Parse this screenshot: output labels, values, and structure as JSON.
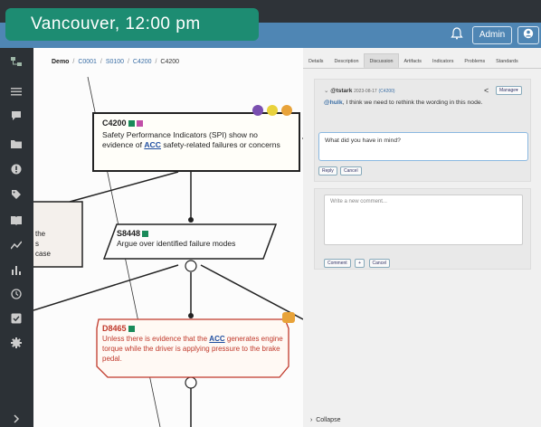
{
  "overlay": {
    "timezone_label": "Vancouver, 12:00 pm"
  },
  "topbar": {
    "notifications_icon": "bell-icon",
    "admin_label": "Admin",
    "user_icon": "user-icon"
  },
  "sidebar": {
    "items": [
      {
        "name": "hierarchy-icon"
      },
      {
        "name": "menu-icon"
      },
      {
        "name": "comments-icon"
      },
      {
        "name": "folder-icon"
      },
      {
        "name": "alert-icon"
      },
      {
        "name": "tag-icon"
      },
      {
        "name": "book-icon"
      },
      {
        "name": "trend-icon"
      },
      {
        "name": "bar-chart-icon"
      },
      {
        "name": "history-icon"
      },
      {
        "name": "checklist-icon"
      },
      {
        "name": "gear-icon"
      }
    ],
    "expand_icon": "chevron-right-icon"
  },
  "breadcrumb": {
    "root": "Demo",
    "sep": "/",
    "c1": "C0001",
    "c2": "S0100",
    "c3": "C4200",
    "current": "C4200"
  },
  "diagram": {
    "c4200": {
      "id": "C4200",
      "text": "Safety Performance Indicators (SPI) show no evidence of ",
      "link": "ACC",
      "text2": " safety-related failures or concerns"
    },
    "left_partial": {
      "l1": "the",
      "l2": "s",
      "l3": "case"
    },
    "s8448": {
      "id": "S8448",
      "text": "Argue over identified failure modes"
    },
    "d8465": {
      "id": "D8465",
      "text": "Unless there is evidence that the ",
      "link": "ACC",
      "text2": " generates engine torque while the driver is applying pressure to the brake pedal."
    },
    "colors": {
      "accent_green": "#1a8a5a",
      "accent_pink": "#c14fa8",
      "defeater_red": "#c0392b",
      "badge_orange": "#e8a33a",
      "badge_purple": "#7a4fb0",
      "badge_yellow": "#e9d23c"
    }
  },
  "tabs": [
    "Details",
    "Description",
    "Discussion",
    "Artifacts",
    "Indicators",
    "Problems",
    "Standards"
  ],
  "discussion": {
    "author": "@tstark",
    "timestamp": "2023-08-17",
    "ref": "(C4200)",
    "manage_label": "Manage",
    "mention": "@hulk",
    "message": ", I think we need to rethink the wording in this node.",
    "reply_value": "What did you have in mind?",
    "reply_button": "Reply",
    "cancel_button": "Cancel",
    "new_placeholder": "Write a new comment...",
    "comment_button": "Comment",
    "plus_label": "+",
    "cancel2_button": "Cancel"
  },
  "footer": {
    "collapse_label": "Collapse"
  }
}
